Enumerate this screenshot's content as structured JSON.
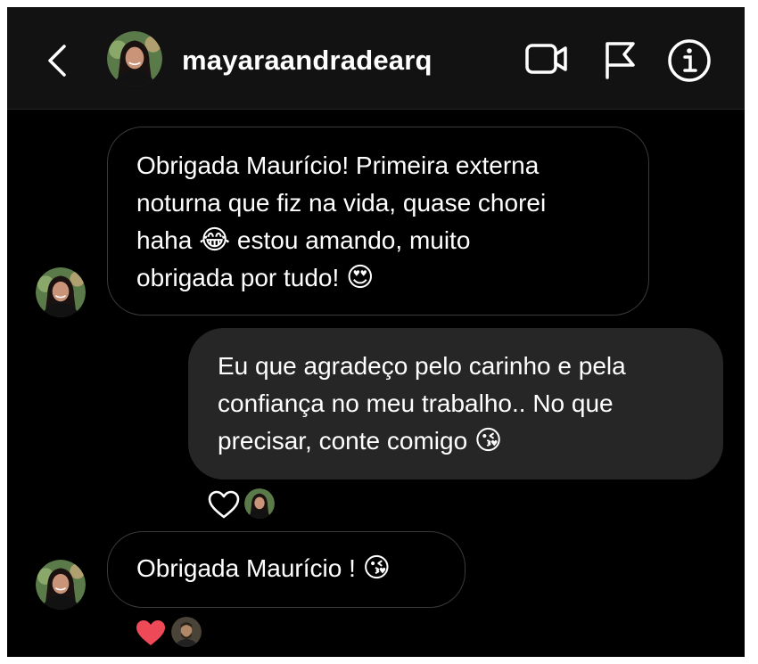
{
  "header": {
    "username": "mayaraandradearq"
  },
  "messages": [
    {
      "direction": "received",
      "lines": [
        "Obrigada Maurício! Primeira externa",
        "noturna que fiz na vida, quase chorei",
        "haha",
        "estou amando, muito",
        "obrigada por tudo!"
      ],
      "emojis": [
        "😂",
        "😍"
      ]
    },
    {
      "direction": "sent",
      "lines": [
        "Eu que agradeço pelo carinho e pela",
        "confiança no meu trabalho.. No que",
        "precisar, conte comigo"
      ],
      "emojis": [
        "😘"
      ],
      "reaction": {
        "icon": "heart-outline-icon"
      }
    },
    {
      "direction": "received",
      "lines": [
        "Obrigada Maurício !"
      ],
      "emojis": [
        "😘"
      ],
      "reaction": {
        "icon": "heart-filled-icon",
        "color": "#ed4956"
      }
    }
  ],
  "colors": {
    "background": "#000000",
    "header": "#121212",
    "sent_bubble": "#262626",
    "received_border": "#3a3a3a",
    "heart_red": "#ed4956",
    "text": "#ffffff"
  }
}
